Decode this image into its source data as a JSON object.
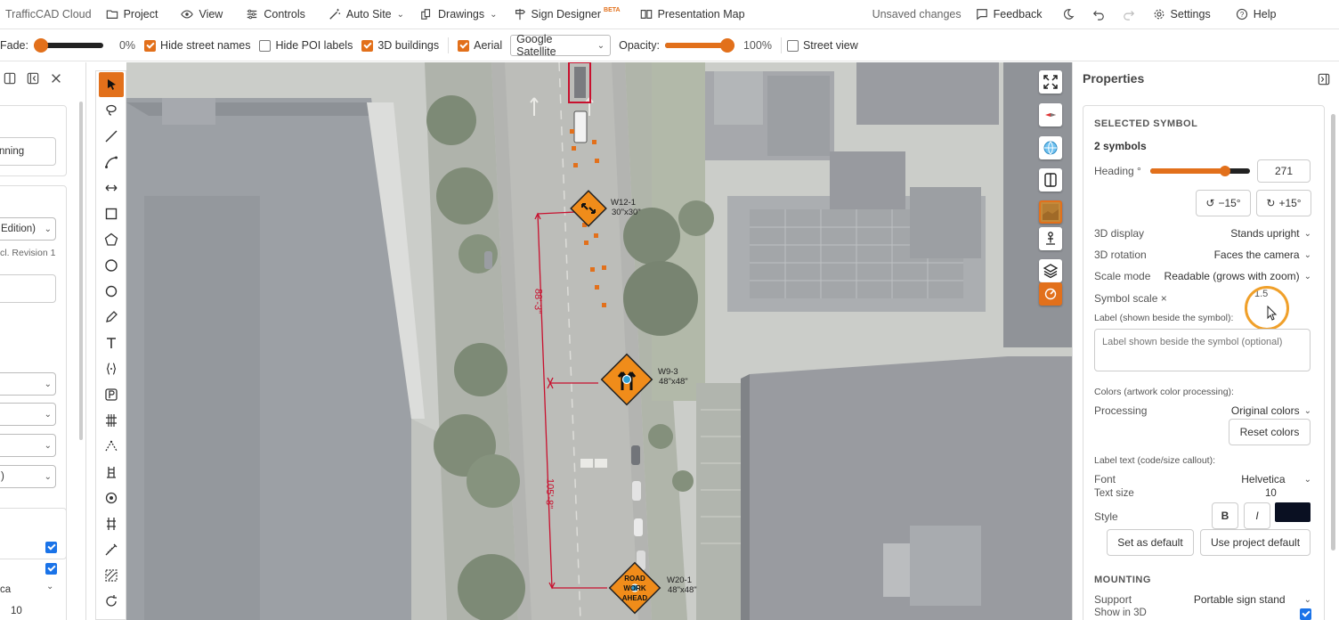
{
  "topbar": {
    "brand": "TrafficCAD Cloud",
    "project": "Project",
    "view": "View",
    "controls": "Controls",
    "auto_site": "Auto Site",
    "drawings": "Drawings",
    "sign_designer": "Sign Designer",
    "beta": "BETA",
    "presentation_map": "Presentation Map",
    "status": "Unsaved changes",
    "feedback": "Feedback",
    "settings": "Settings",
    "help": "Help"
  },
  "optbar": {
    "fade_label": "Fade:",
    "fade_value": "0%",
    "fade_level": 0,
    "hide_street_names": "Hide street names",
    "hide_poi_labels": "Hide POI labels",
    "buildings_3d": "3D buildings",
    "aerial": "Aerial",
    "basemap": "Google Satellite",
    "opacity_label": "Opacity:",
    "opacity_value": "100%",
    "opacity_level": 1.0,
    "street_view": "Street view"
  },
  "leftpanel": {
    "planning": "nning",
    "edition": "Edition)",
    "revision": "cl. Revision 1",
    "font_partial": "ca",
    "size_value": "10"
  },
  "map": {
    "sign_w12": "W12-1",
    "sign_w12_size": "30\"x30\"",
    "sign_w9": "W9-3",
    "sign_w9_size": "48\"x48\"",
    "sign_w20": "W20-1",
    "sign_w20_size": "48\"x48\"",
    "road_work_1": "ROAD",
    "road_work_2": "WORK",
    "road_work_3": "AHEAD",
    "dim_1": "88'-3\"",
    "dim_2": "105'-8\""
  },
  "props": {
    "title": "Properties",
    "selected_symbol": "SELECTED SYMBOL",
    "count": "2 symbols",
    "heading_label": "Heading °",
    "heading_value": "271",
    "heading_level": 0.75,
    "rot_minus": "−15°",
    "rot_plus": "+15°",
    "display_3d_label": "3D display",
    "display_3d_value": "Stands upright",
    "rotation_3d_label": "3D rotation",
    "rotation_3d_value": "Faces the camera",
    "scale_mode_label": "Scale mode",
    "scale_mode_value": "Readable (grows with zoom)",
    "symbol_scale_label": "Symbol scale ×",
    "symbol_scale_value": "1.5",
    "label_label": "Label (shown beside the symbol):",
    "label_placeholder": "Label shown beside the symbol (optional)",
    "colors_label": "Colors (artwork color processing):",
    "processing_label": "Processing",
    "processing_value": "Original colors",
    "reset_colors": "Reset colors",
    "label_text_label": "Label text (code/size callout):",
    "font_label": "Font",
    "font_value": "Helvetica",
    "text_size_label": "Text size",
    "text_size_value": "10",
    "style_label": "Style",
    "bold": "B",
    "italic": "I",
    "style_color": "#0a1022",
    "set_default": "Set as default",
    "use_project_default": "Use project default",
    "mounting": "MOUNTING",
    "support_label": "Support",
    "support_value": "Portable sign stand",
    "show_3d_label": "Show in 3D"
  },
  "colors": {
    "accent": "#e2701b",
    "sign_orange": "#f08c1a",
    "dimension_red": "#c8102e"
  }
}
